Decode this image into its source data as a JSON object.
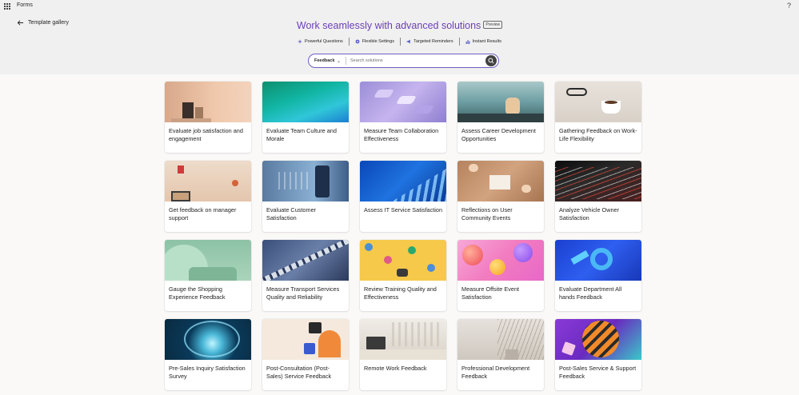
{
  "app": {
    "name": "Forms",
    "help": "?"
  },
  "nav": {
    "back_label": "Template gallery"
  },
  "hero": {
    "title": "Work seamlessly with advanced solutions",
    "badge": "Preview"
  },
  "features": [
    {
      "label": "Powerful Questions",
      "icon": "sparkle-icon"
    },
    {
      "label": "Flexible Settings",
      "icon": "gear-icon"
    },
    {
      "label": "Targeted Reminders",
      "icon": "megaphone-icon"
    },
    {
      "label": "Instant Results",
      "icon": "bar-chart-icon"
    }
  ],
  "search": {
    "filter_value": "Feedback",
    "placeholder": "Search solutions"
  },
  "cards": [
    {
      "title": "Evaluate job satisfaction and engagement"
    },
    {
      "title": "Evaluate Team Culture and Morale"
    },
    {
      "title": "Measure Team Collaboration Effectiveness"
    },
    {
      "title": "Assess Career Development Opportunities"
    },
    {
      "title": "Gathering Feedback on Work-Life Flexibility"
    },
    {
      "title": "Get feedback on manager support"
    },
    {
      "title": "Evaluate Customer Satisfaction"
    },
    {
      "title": "Assess IT Service Satisfaction"
    },
    {
      "title": "Reflections on User Community Events"
    },
    {
      "title": "Analyze Vehicle Owner Satisfaction"
    },
    {
      "title": "Gauge the Shopping Experience Feedback"
    },
    {
      "title": "Measure Transport Services Quality and Reliability"
    },
    {
      "title": "Review Training Quality and Effectiveness"
    },
    {
      "title": "Measure Offsite Event Satisfaction"
    },
    {
      "title": "Evaluate Department All hands Feedback"
    },
    {
      "title": "Pre-Sales Inquiry Satisfaction Survey"
    },
    {
      "title": "Post-Consultation (Post-Sales) Service Feedback"
    },
    {
      "title": "Remote Work Feedback"
    },
    {
      "title": "Professional Development Feedback"
    },
    {
      "title": "Post-Sales Service & Support Feedback"
    }
  ],
  "colors": {
    "accent": "#6b3fb5",
    "search_border": "#6d5fc4"
  }
}
